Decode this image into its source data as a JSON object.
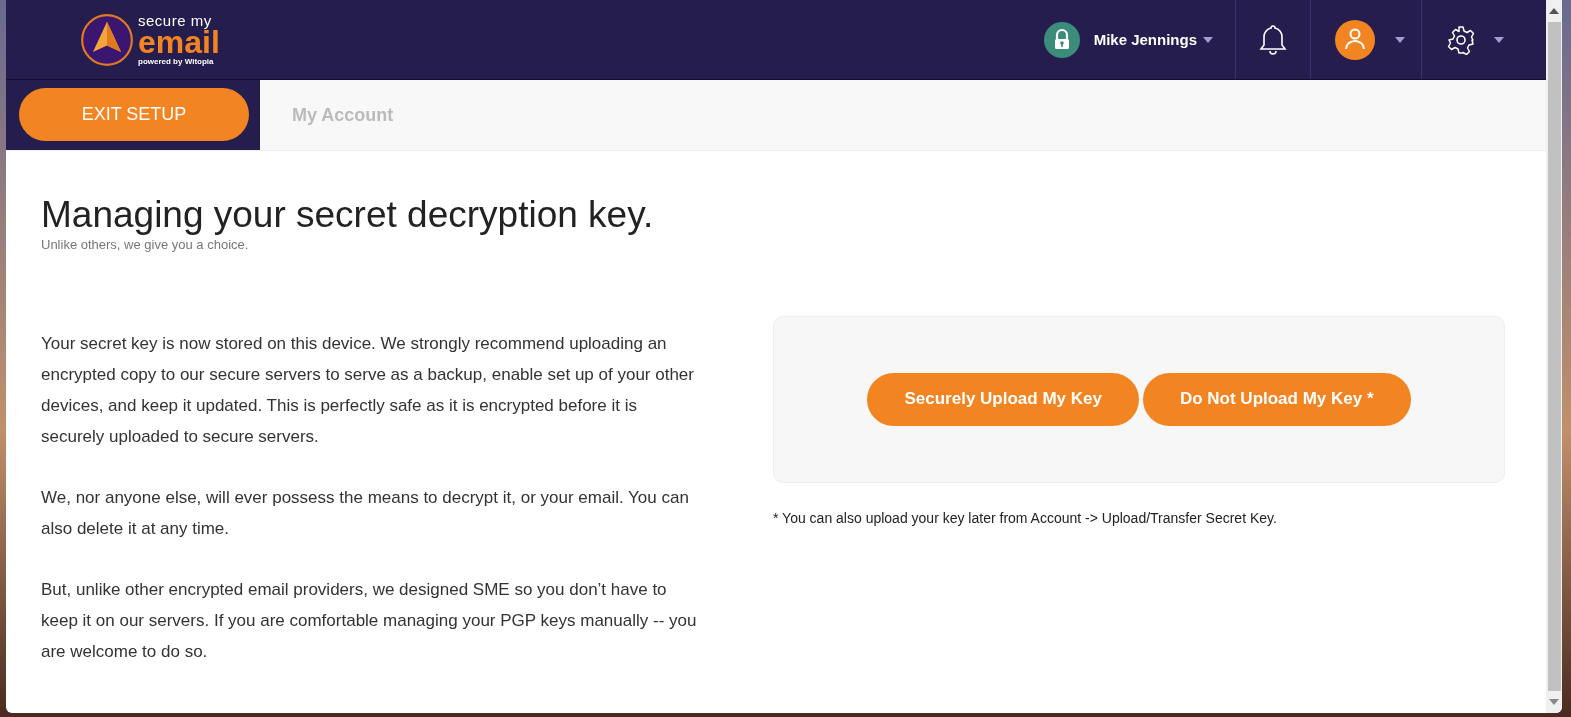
{
  "logo": {
    "line1": "secure my",
    "line2": "email",
    "tagline": "powered by Witopia"
  },
  "user": {
    "name": "Mike Jennings",
    "locked": true
  },
  "exit_button": "EXIT SETUP",
  "tabs": [
    {
      "label": "My Account",
      "selected": false
    }
  ],
  "heading": "Managing your secret decryption key.",
  "subheading": "Unlike others, we give you a choice.",
  "paragraphs": [
    "Your secret key is now stored on this device. We strongly recommend uploading an encrypted copy to our secure servers to serve as a backup, enable set up of your other devices, and keep it updated. This is perfectly safe as it is encrypted before it is securely uploaded to secure servers.",
    "We, nor anyone else, will ever possess the means to decrypt it, or your email. You can also delete it at any time.",
    "But, unlike other encrypted email providers, we designed SME so you don’t have to keep it on our servers. If you are comfortable managing your PGP keys manually -- you are welcome to do so."
  ],
  "buttons": [
    "Securely Upload My Key",
    "Do Not Upload My Key *"
  ],
  "note": "* You can also upload your key later from Account -> Upload/Transfer Secret Key."
}
